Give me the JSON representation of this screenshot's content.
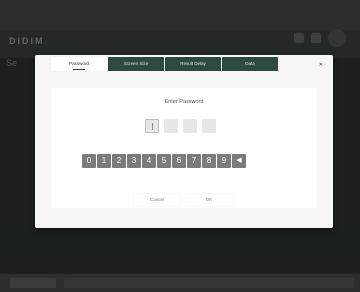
{
  "app": {
    "brand": "DIDIM",
    "side_label": "Se"
  },
  "dialog": {
    "tabs": [
      {
        "label": "Password"
      },
      {
        "label": "Screen Size"
      },
      {
        "label": "Result Delay"
      },
      {
        "label": "Data"
      }
    ],
    "close_icon": "close-icon",
    "prompt": "Enter Password",
    "keys": [
      "0",
      "1",
      "2",
      "3",
      "4",
      "5",
      "6",
      "7",
      "8",
      "9"
    ],
    "backspace_glyph": "◀",
    "cancel_label": "Cancel",
    "ok_label": "OK"
  },
  "colors": {
    "tab_bg": "#2d4a41",
    "key_bg": "#7b7b7b",
    "dialog_bg": "#f6f6f6"
  }
}
